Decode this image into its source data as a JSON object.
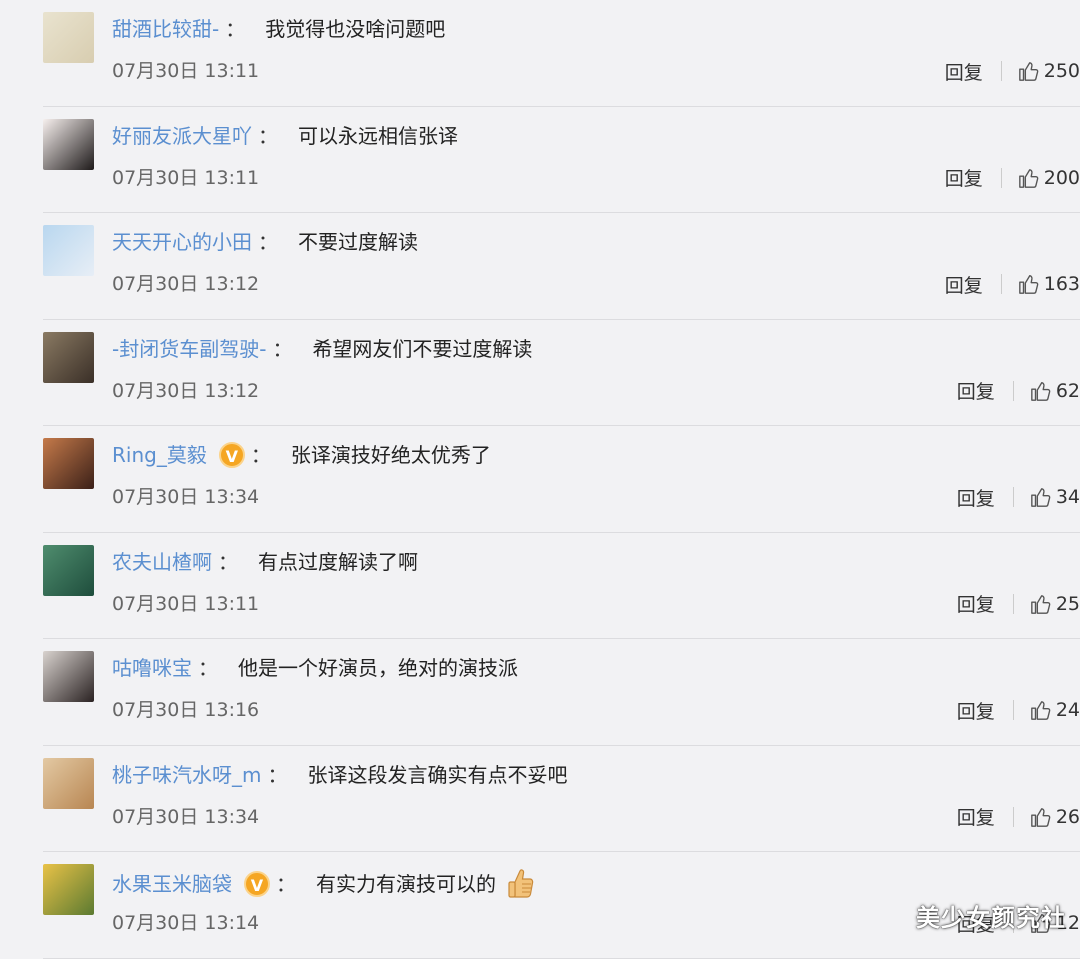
{
  "reply_label": "回复",
  "colon": "：",
  "comments": [
    {
      "user": "甜酒比较甜-",
      "text": "我觉得也没啥问题吧",
      "date": "07月30日 13:11",
      "likes": "250",
      "verified": false,
      "avatar_colors": [
        "#e9e3cf",
        "#d8cdb0"
      ]
    },
    {
      "user": "好丽友派大星吖",
      "text": "可以永远相信张译",
      "date": "07月30日 13:11",
      "likes": "200",
      "verified": false,
      "avatar_colors": [
        "#f7f0ee",
        "#1e1a1a"
      ]
    },
    {
      "user": "天天开心的小田",
      "text": "不要过度解读",
      "date": "07月30日 13:12",
      "likes": "163",
      "verified": false,
      "avatar_colors": [
        "#b9d7ef",
        "#e7eef6"
      ]
    },
    {
      "user": "-封闭货车副驾驶-",
      "text": "希望网友们不要过度解读",
      "date": "07月30日 13:12",
      "likes": "62",
      "verified": false,
      "avatar_colors": [
        "#8a7a63",
        "#3a2f27"
      ]
    },
    {
      "user": "Ring_莫毅",
      "text": "张译演技好绝太优秀了",
      "date": "07月30日 13:34",
      "likes": "34",
      "verified": true,
      "avatar_colors": [
        "#c57a4a",
        "#3b2018"
      ]
    },
    {
      "user": "农夫山楂啊",
      "text": "有点过度解读了啊",
      "date": "07月30日 13:11",
      "likes": "25",
      "verified": false,
      "avatar_colors": [
        "#4f8d6e",
        "#1e4d3c"
      ]
    },
    {
      "user": "咕噜咪宝",
      "text": "他是一个好演员，绝对的演技派",
      "date": "07月30日 13:16",
      "likes": "24",
      "verified": false,
      "avatar_colors": [
        "#d9d3cf",
        "#2a2222"
      ]
    },
    {
      "user": "桃子味汽水呀_m",
      "text": "张译这段发言确实有点不妥吧",
      "date": "07月30日 13:34",
      "likes": "26",
      "verified": false,
      "avatar_colors": [
        "#e3c9a3",
        "#b88652"
      ]
    },
    {
      "user": "水果玉米脑袋",
      "text": "有实力有演技可以的",
      "date": "07月30日 13:14",
      "likes": "12",
      "verified": true,
      "emoji": "thumbs-up",
      "avatar_colors": [
        "#e9c247",
        "#5b7a31"
      ]
    }
  ],
  "icons": {
    "like": "thumbs-up-icon",
    "verified": "verified-v-badge-icon"
  },
  "colors": {
    "username": "#5b8fd0",
    "verified_badge": "#f5a623",
    "background": "#f2f2f4"
  },
  "watermark": "美少女颜究社"
}
